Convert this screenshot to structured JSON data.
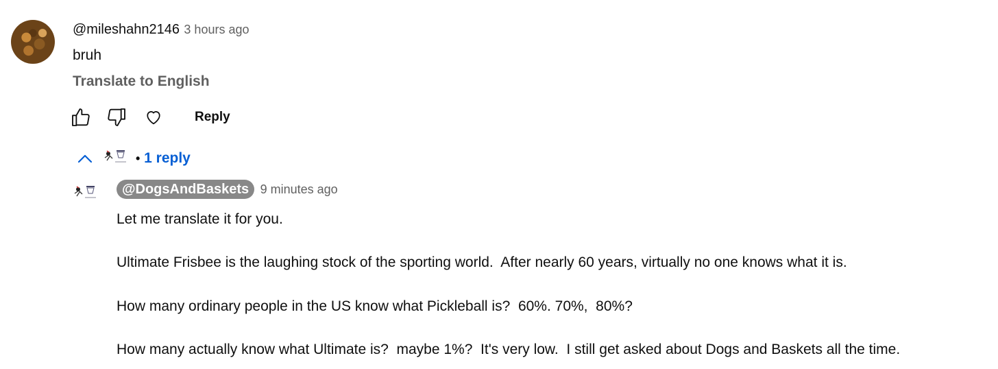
{
  "comment": {
    "username": "@mileshahn2146",
    "timestamp": "3 hours ago",
    "text": "bruh",
    "translate_label": "Translate to English",
    "reply_label": "Reply"
  },
  "replies_toggle": {
    "bullet": "•",
    "label": "1 reply"
  },
  "reply": {
    "username": "@DogsAndBaskets",
    "timestamp": "9 minutes ago",
    "paragraphs": [
      "Let me translate it for you.",
      "Ultimate Frisbee is the laughing stock of the sporting world.  After nearly 60 years, virtually no one knows what it is.",
      "How many ordinary people in the US know what Pickleball is?  60%. 70%,  80%?",
      "How many actually know what Ultimate is?  maybe 1%?  It's very low.  I still get asked about Dogs and Baskets all the time."
    ]
  },
  "icons": {
    "like": "thumbs-up-icon",
    "dislike": "thumbs-down-icon",
    "heart": "heart-icon",
    "chevron": "chevron-up-icon"
  },
  "colors": {
    "link_blue": "#065fd4",
    "meta_gray": "#606060",
    "chip_gray": "#888888"
  }
}
